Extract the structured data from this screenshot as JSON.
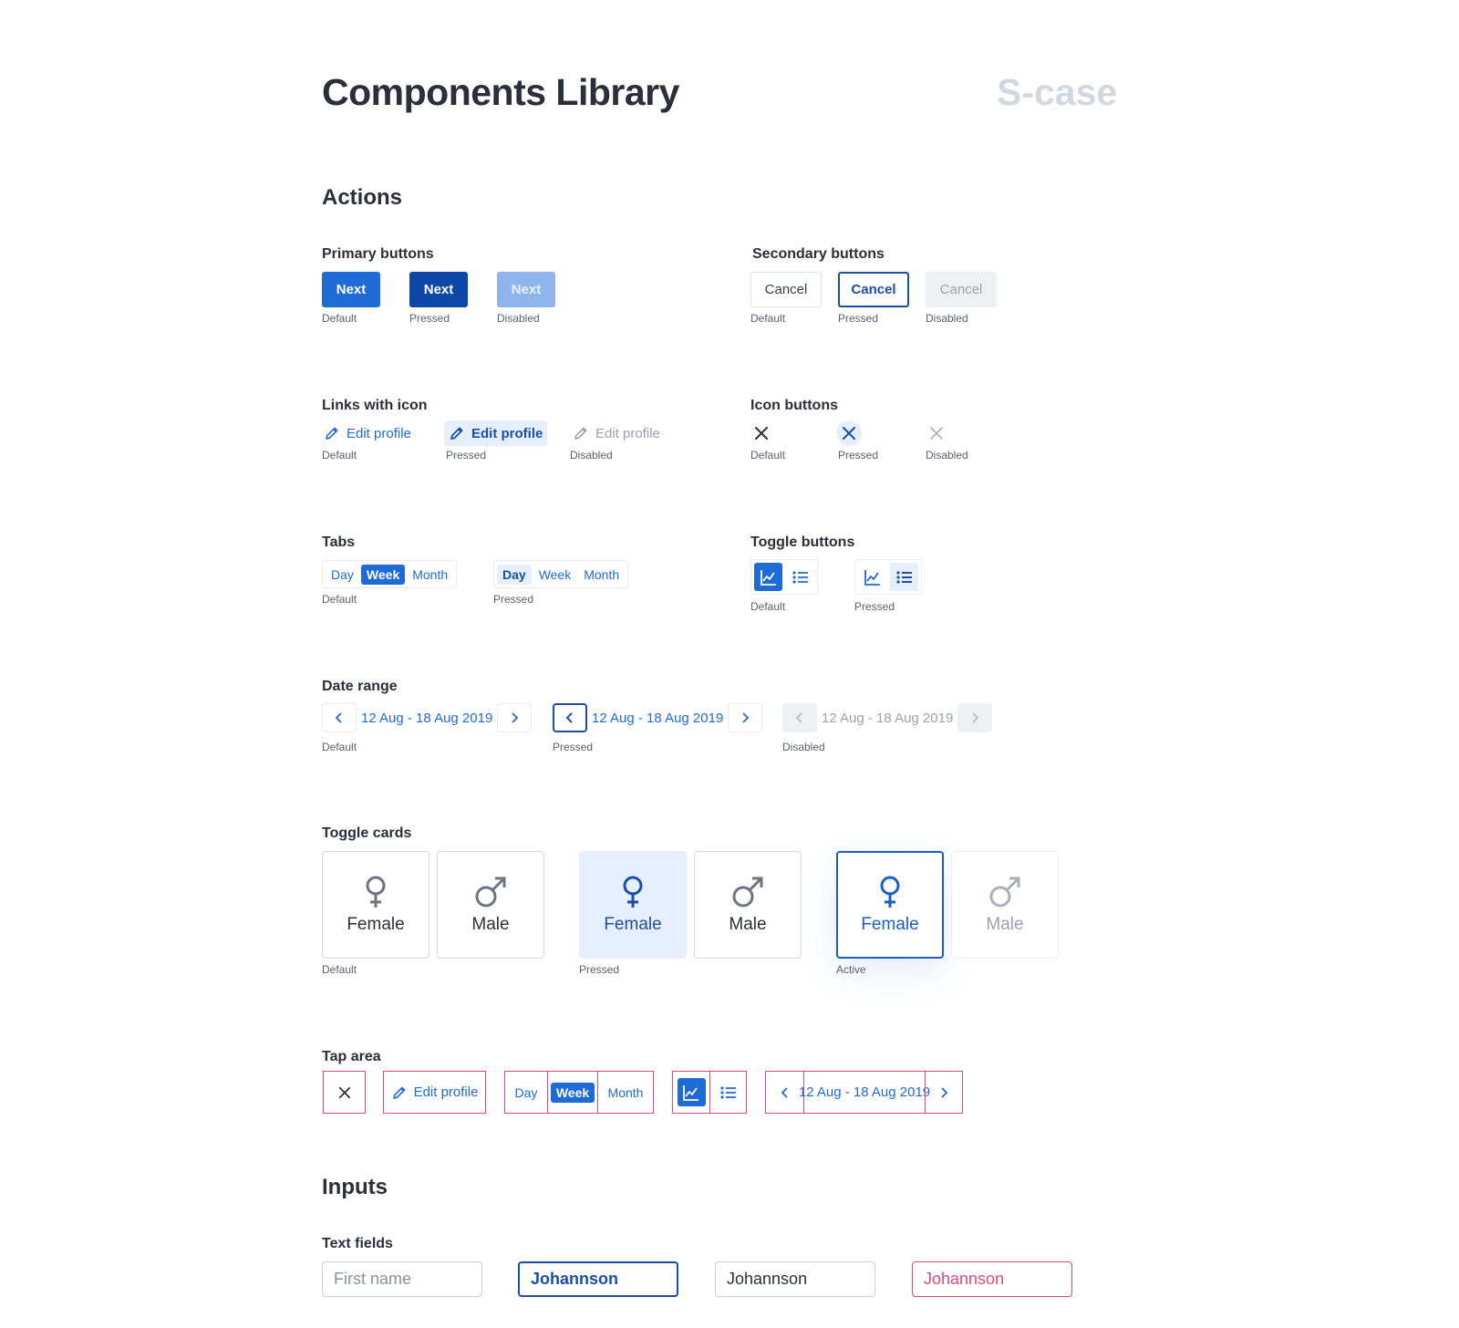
{
  "header": {
    "title": "Components Library",
    "brand": "S-case"
  },
  "actions": {
    "heading": "Actions",
    "primary": {
      "title": "Primary buttons",
      "label": "Next",
      "states": [
        "Default",
        "Pressed",
        "Disabled"
      ]
    },
    "secondary": {
      "title": "Secondary buttons",
      "label": "Cancel",
      "states": [
        "Default",
        "Pressed",
        "Disabled"
      ]
    },
    "links": {
      "title": "Links with icon",
      "label": "Edit profile",
      "states": [
        "Default",
        "Pressed",
        "Disabled"
      ]
    },
    "icon_buttons": {
      "title": "Icon buttons",
      "states": [
        "Default",
        "Pressed",
        "Disabled"
      ]
    },
    "tabs": {
      "title": "Tabs",
      "items": [
        "Day",
        "Week",
        "Month"
      ],
      "states": [
        "Default",
        "Pressed"
      ]
    },
    "toggle_buttons": {
      "title": "Toggle buttons",
      "states": [
        "Default",
        "Pressed"
      ]
    },
    "date_range": {
      "title": "Date range",
      "value": "12 Aug - 18 Aug 2019",
      "states": [
        "Default",
        "Pressed",
        "Disabled"
      ]
    },
    "toggle_cards": {
      "title": "Toggle cards",
      "female": "Female",
      "male": "Male",
      "states": [
        "Default",
        "Pressed",
        "Active"
      ]
    },
    "tap_area": {
      "title": "Tap area"
    }
  },
  "inputs": {
    "heading": "Inputs",
    "text_fields": {
      "title": "Text fields",
      "placeholder": "First name",
      "value": "Johannson"
    }
  },
  "colors": {
    "primary": "#1f6bd6",
    "primary_pressed": "#0d47a8",
    "primary_disabled": "#8fb6ec",
    "text": "#2b2f3a",
    "error": "#e04a7a",
    "soft": "#e5effd"
  }
}
